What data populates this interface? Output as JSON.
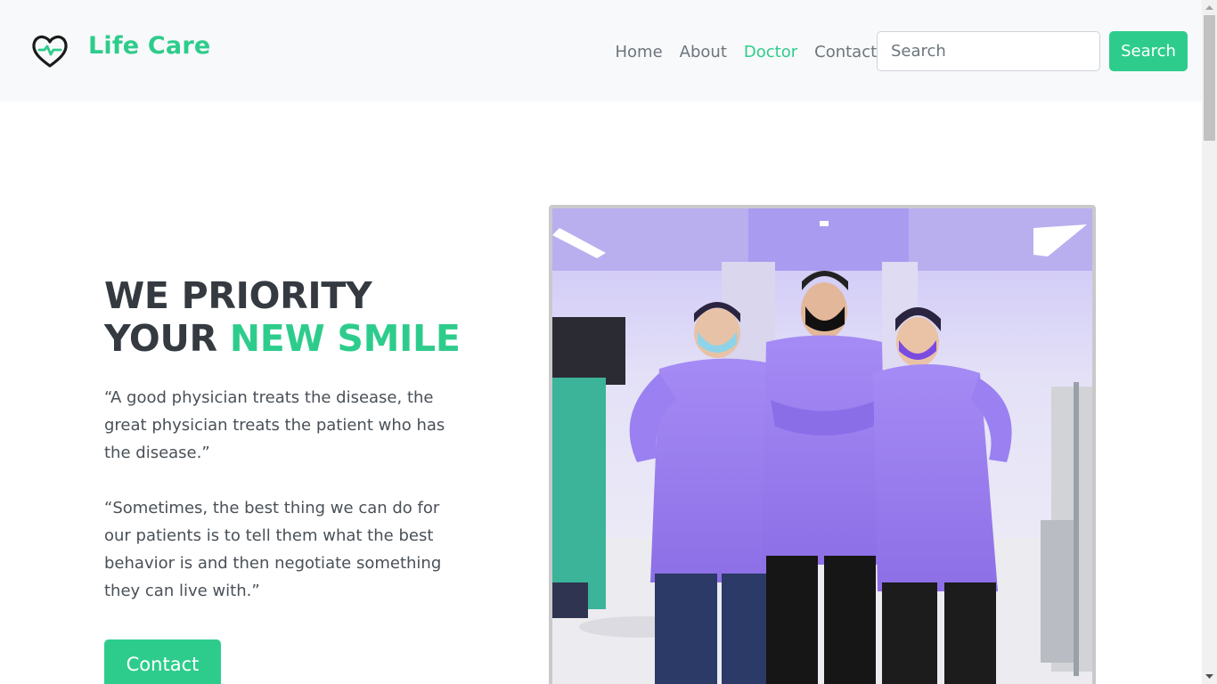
{
  "brand": {
    "icon": "heart-pulse-icon",
    "name": "Life Care",
    "accent_color": "#2ecc8c"
  },
  "nav": {
    "items": [
      {
        "label": "Home",
        "active": false
      },
      {
        "label": "About",
        "active": false
      },
      {
        "label": "Doctor",
        "active": true
      },
      {
        "label": "Contact",
        "active": false
      }
    ]
  },
  "search": {
    "placeholder": "Search",
    "value": "",
    "button_label": "Search"
  },
  "hero": {
    "title_line1": "WE PRIORITY",
    "title_line2_prefix": "YOUR ",
    "title_line2_accent": "NEW SMILE",
    "quote1": "“A good physician treats the disease, the great physician treats the patient who has the disease.”",
    "quote2": "“Sometimes, the best thing we can do for our patients is to tell them what the best behavior is and then negotiate something they can live with.”",
    "contact_label": "Contact"
  },
  "photo": {
    "subject": "three medical staff in purple gowns"
  },
  "colors": {
    "accent": "#2ecc8c",
    "navbar_bg": "#f8f9fa",
    "text_dark": "#343a40",
    "gown_purple": "#9b7ff0"
  }
}
